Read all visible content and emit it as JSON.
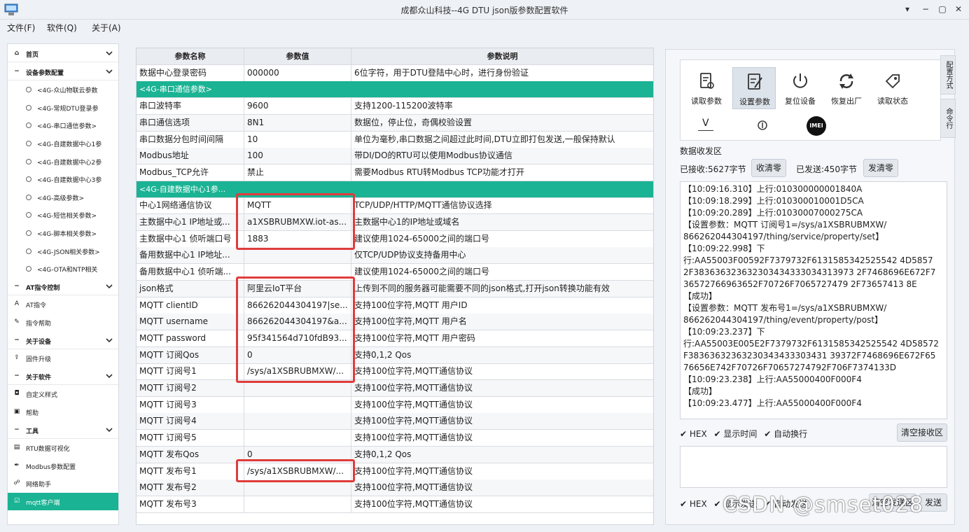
{
  "window": {
    "title": "成都众山科技--4G DTU json版参数配置软件",
    "minimize": "−",
    "restore": "▢",
    "close": "✕",
    "extra": "▾"
  },
  "menu": [
    "文件(F)",
    "软件(Q)",
    "关于(A)"
  ],
  "sidebar": {
    "items": [
      {
        "label": "首页",
        "type": "head",
        "icon": "home-icon",
        "glyph": "⌂"
      },
      {
        "label": "设备参数配置",
        "type": "head",
        "icon": "minus-icon",
        "glyph": "−"
      },
      {
        "label": "<4G-众山物联云参数",
        "type": "child"
      },
      {
        "label": "<4G-常规DTU登录参",
        "type": "child"
      },
      {
        "label": "<4G-串口通信参数>",
        "type": "child"
      },
      {
        "label": "<4G-自建数据中心1参",
        "type": "child"
      },
      {
        "label": "<4G-自建数据中心2参",
        "type": "child"
      },
      {
        "label": "<4G-自建数据中心3参",
        "type": "child"
      },
      {
        "label": "<4G-高级参数>",
        "type": "child"
      },
      {
        "label": "<4G-短信相关参数>",
        "type": "child"
      },
      {
        "label": "<4G-脚本相关参数>",
        "type": "child"
      },
      {
        "label": "<4G-JSON相关参数>",
        "type": "child"
      },
      {
        "label": "<4G-OTA和NTP相关",
        "type": "child"
      },
      {
        "label": "AT指令控制",
        "type": "head",
        "icon": "minus-icon",
        "glyph": "−"
      },
      {
        "label": "AT指令",
        "type": "leaf",
        "icon": "at-icon",
        "glyph": "A"
      },
      {
        "label": "指令帮助",
        "type": "leaf",
        "icon": "pen-icon",
        "glyph": "✎"
      },
      {
        "label": "关于设备",
        "type": "head",
        "icon": "minus-icon",
        "glyph": "−"
      },
      {
        "label": "固件升级",
        "type": "leaf",
        "icon": "upgrade-icon",
        "glyph": "⇪"
      },
      {
        "label": "关于软件",
        "type": "head",
        "icon": "minus-icon",
        "glyph": "−"
      },
      {
        "label": "自定义样式",
        "type": "leaf",
        "icon": "style-icon",
        "glyph": "◘"
      },
      {
        "label": "帮助",
        "type": "leaf",
        "icon": "help-icon",
        "glyph": "▣"
      },
      {
        "label": "工具",
        "type": "head",
        "icon": "minus-icon",
        "glyph": "−"
      },
      {
        "label": "RTU数据可视化",
        "type": "leaf",
        "icon": "chart-icon",
        "glyph": "▤"
      },
      {
        "label": "Modbus参数配置",
        "type": "leaf",
        "icon": "wrench-icon",
        "glyph": "✒"
      },
      {
        "label": "网络助手",
        "type": "leaf",
        "icon": "network-icon",
        "glyph": "☍"
      },
      {
        "label": "mqtt客户端",
        "type": "active",
        "icon": "mqtt-icon",
        "glyph": "☑"
      }
    ]
  },
  "grid": {
    "headers": [
      "参数名称",
      "参数值",
      "参数说明"
    ],
    "rows": [
      {
        "type": "row",
        "name": "数据中心登录密码",
        "value": "000000",
        "desc": "6位字符，用于DTU登陆中心时，进行身份验证"
      },
      {
        "type": "section",
        "name": "<4G-串口通信参数>",
        "value": "",
        "desc": ""
      },
      {
        "type": "row",
        "name": "串口波特率",
        "value": "9600",
        "desc": "支持1200-115200波特率"
      },
      {
        "type": "row",
        "name": "串口通信选项",
        "value": "8N1",
        "desc": "数据位，停止位，奇偶校验设置"
      },
      {
        "type": "row",
        "name": "串口数据分包时间间隔",
        "value": "10",
        "desc": "单位为毫秒,串口数据之间超过此时间,DTU立即打包发送,一般保持默认"
      },
      {
        "type": "row",
        "name": "Modbus地址",
        "value": "100",
        "desc": "带DI/DO的RTU可以使用Modbus协议通信"
      },
      {
        "type": "row",
        "name": "Modbus_TCP允许",
        "value": "禁止",
        "desc": "需要Modbus RTU转Modbus TCP功能才打开"
      },
      {
        "type": "section",
        "name": "<4G-自建数据中心1参...",
        "value": "",
        "desc": ""
      },
      {
        "type": "row",
        "name": "中心1网络通信协议",
        "value": "MQTT",
        "desc": "TCP/UDP/HTTP/MQTT通信协议选择"
      },
      {
        "type": "row",
        "name": "主数据中心1 IP地址或...",
        "value": "a1XSBRUBMXW.iot-as...",
        "desc": "主数据中心1的IP地址或域名"
      },
      {
        "type": "row",
        "name": "主数据中心1 侦听端口号",
        "value": "1883",
        "desc": "建议使用1024-65000之间的端口号"
      },
      {
        "type": "row",
        "name": "备用数据中心1 IP地址...",
        "value": "",
        "desc": "仅TCP/UDP协议支持备用中心"
      },
      {
        "type": "row",
        "name": "备用数据中心1 侦听端...",
        "value": "",
        "desc": "建议使用1024-65000之间的端口号"
      },
      {
        "type": "row",
        "name": "json格式",
        "value": "阿里云IoT平台",
        "desc": "上传到不同的服务器可能需要不同的json格式,打开json转换功能有效"
      },
      {
        "type": "row",
        "name": "MQTT clientID",
        "value": "866262044304197|se...",
        "desc": "支持100位字符,MQTT 用户ID"
      },
      {
        "type": "row",
        "name": "MQTT username",
        "value": "866262044304197&a...",
        "desc": "支持100位字符,MQTT 用户名"
      },
      {
        "type": "row",
        "name": "MQTT password",
        "value": "95f341564d710fdB93...",
        "desc": "支持100位字符,MQTT 用户密码"
      },
      {
        "type": "row",
        "name": "MQTT 订阅Qos",
        "value": "0",
        "desc": "支持0,1,2 Qos"
      },
      {
        "type": "row",
        "name": "MQTT 订阅号1",
        "value": "/sys/a1XSBRUBMXW/...",
        "desc": "支持100位字符,MQTT通信协议"
      },
      {
        "type": "row",
        "name": "MQTT 订阅号2",
        "value": "",
        "desc": "支持100位字符,MQTT通信协议"
      },
      {
        "type": "row",
        "name": "MQTT 订阅号3",
        "value": "",
        "desc": "支持100位字符,MQTT通信协议"
      },
      {
        "type": "row",
        "name": "MQTT 订阅号4",
        "value": "",
        "desc": "支持100位字符,MQTT通信协议"
      },
      {
        "type": "row",
        "name": "MQTT 订阅号5",
        "value": "",
        "desc": "支持100位字符,MQTT通信协议"
      },
      {
        "type": "row",
        "name": "MQTT 发布Qos",
        "value": "0",
        "desc": "支持0,1,2 Qos"
      },
      {
        "type": "row",
        "name": "MQTT 发布号1",
        "value": "/sys/a1XSBRUBMXW/...",
        "desc": "支持100位字符,MQTT通信协议"
      },
      {
        "type": "row",
        "name": "MQTT 发布号2",
        "value": "",
        "desc": "支持100位字符,MQTT通信协议"
      },
      {
        "type": "row",
        "name": "MQTT 发布号3",
        "value": "",
        "desc": "支持100位字符,MQTT通信协议"
      }
    ]
  },
  "toolbar": {
    "buttons": [
      {
        "label": "读取参数",
        "icon": "read-params-icon"
      },
      {
        "label": "设置参数",
        "icon": "set-params-icon"
      },
      {
        "label": "复位设备",
        "icon": "reset-device-icon"
      },
      {
        "label": "恢复出厂",
        "icon": "factory-reset-icon"
      },
      {
        "label": "读取状态",
        "icon": "read-status-icon"
      }
    ],
    "small": [
      {
        "label": "V",
        "icon": "version-icon"
      },
      {
        "label": "",
        "icon": "signal-icon"
      },
      {
        "label": "IMEI",
        "icon": "imei-icon"
      }
    ]
  },
  "sidetabs": [
    "配置方式",
    "命令行"
  ],
  "recv": {
    "title": "数据收发区",
    "received": "已接收:5627字节",
    "clear_recv_count": "收清零",
    "sent": "已发送:450字节",
    "clear_sent_count": "发清零",
    "log": [
      "【10:09:16.310】上行:010300000001840A",
      "【10:09:18.299】上行:010300010001D5CA",
      "【10:09:20.289】上行:01030007000275CA",
      "【设置参数：MQTT 订阅号1=/sys/a1XSBRUBMXW/",
      "866262044304197/thing/service/property/set】",
      "【10:09:22.998】下",
      "行:AA55003F00592F7379732F6131585342525542 4D5857",
      "2F383636323632303434333034313973 2F7468696E672F7",
      "36572766963652F70726F7065727479 2F73657413 8E",
      "【成功】",
      "【设置参数：MQTT 发布号1=/sys/a1XSBRUBMXW/",
      "866262044304197/thing/event/property/post】",
      "【10:09:23.237】下",
      "行:AA55003E005E2F7379732F6131585342525542 4D58572",
      "F38363632363230343433303431 39372F7468696E672F65",
      "76656E742F70726F70657274792F706F7374133D",
      "【10:09:23.238】上行:AA55000400F000F4",
      "【成功】",
      "【10:09:23.477】上行:AA55000400F000F4"
    ],
    "hex": "HEX",
    "show_time": "显示时间",
    "auto_wrap": "自动换行",
    "clear_recv_area": "清空接收区"
  },
  "send": {
    "hex": "HEX",
    "show_send": "显示发送",
    "auto_send": "自动发送",
    "clear_send": "清空发送区",
    "send_btn": "发送"
  },
  "watermark": "CSDN @smset028",
  "colors": {
    "accent": "#1ab394",
    "highlight_box": "#e03c3c"
  }
}
